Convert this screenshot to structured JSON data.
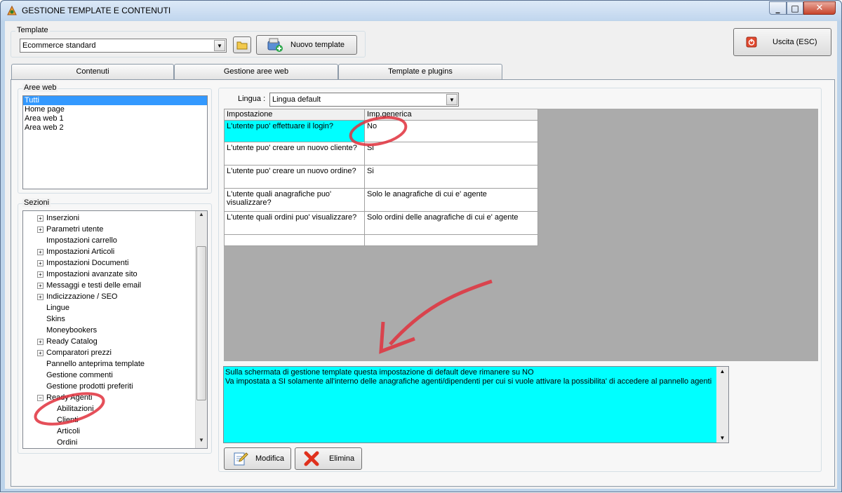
{
  "window": {
    "title": "GESTIONE TEMPLATE E CONTENUTI"
  },
  "template_group": {
    "label": "Template",
    "combo_value": "Ecommerce standard",
    "new_template_label": "Nuovo template"
  },
  "exit_button": {
    "label": "Uscita (ESC)"
  },
  "tabs": [
    {
      "label": "Contenuti"
    },
    {
      "label": "Gestione aree web"
    },
    {
      "label": "Template e plugins"
    }
  ],
  "aree_web": {
    "label": "Aree web",
    "items": [
      "Tutti",
      "Home page",
      "Area web 1",
      "Area web 2"
    ],
    "selected": "Tutti"
  },
  "sezioni": {
    "label": "Sezioni",
    "items": [
      {
        "label": "Inserzioni",
        "expandable": true
      },
      {
        "label": "Parametri utente",
        "expandable": true
      },
      {
        "label": "Impostazioni carrello",
        "expandable": false
      },
      {
        "label": "Impostazioni Articoli",
        "expandable": true
      },
      {
        "label": "Impostazioni Documenti",
        "expandable": true
      },
      {
        "label": "Impostazioni avanzate sito",
        "expandable": true
      },
      {
        "label": "Messaggi e testi delle email",
        "expandable": true
      },
      {
        "label": "Indicizzazione / SEO",
        "expandable": true
      },
      {
        "label": "Lingue",
        "expandable": false
      },
      {
        "label": "Skins",
        "expandable": false
      },
      {
        "label": "Moneybookers",
        "expandable": false
      },
      {
        "label": "Ready Catalog",
        "expandable": true
      },
      {
        "label": "Comparatori prezzi",
        "expandable": true
      },
      {
        "label": "Pannello anteprima template",
        "expandable": false
      },
      {
        "label": "Gestione commenti",
        "expandable": false
      },
      {
        "label": "Gestione prodotti preferiti",
        "expandable": false
      },
      {
        "label": "Ready Agenti",
        "expandable": true,
        "expanded": true
      },
      {
        "label": "Abilitazioni",
        "child": true
      },
      {
        "label": "Clienti",
        "child": true
      },
      {
        "label": "Articoli",
        "child": true
      },
      {
        "label": "Ordini",
        "child": true
      }
    ]
  },
  "lingua": {
    "label": "Lingua :",
    "value": "Lingua default"
  },
  "grid": {
    "headers": [
      "Impostazione",
      "Imp.generica"
    ],
    "rows": [
      {
        "setting": "L'utente puo' effettuare il login?",
        "value": "No"
      },
      {
        "setting": "L'utente puo' creare un nuovo cliente?",
        "value": "Si"
      },
      {
        "setting": "L'utente puo' creare un nuovo ordine?",
        "value": "Si"
      },
      {
        "setting": "L'utente quali anagrafiche puo' visualizzare?",
        "value": "Solo le anagrafiche di cui e' agente"
      },
      {
        "setting": "L'utente quali ordini puo' visualizzare?",
        "value": "Solo ordini delle anagrafiche di cui e' agente"
      }
    ]
  },
  "memo": {
    "line1": "Sulla schermata di gestione template questa impostazione di default deve rimanere su NO",
    "line2": "Va impostata a SI solamente all'interno delle anagrafiche agenti/dipendenti per cui si vuole attivare la possibilita' di accedere al pannello agenti"
  },
  "buttons": {
    "modifica": "Modifica",
    "elimina": "Elimina"
  },
  "colors": {
    "selection": "#3399ff",
    "highlight": "#00ffff",
    "annotation": "#e0303c"
  }
}
